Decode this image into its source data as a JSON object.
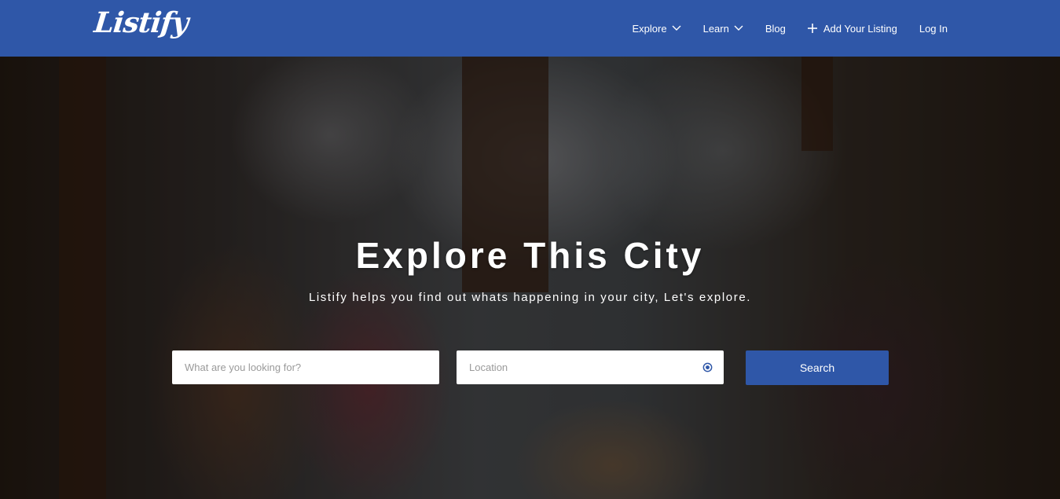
{
  "header": {
    "logo": "Listify",
    "nav": [
      {
        "label": "Explore",
        "has_dropdown": true
      },
      {
        "label": "Learn",
        "has_dropdown": true
      },
      {
        "label": "Blog",
        "has_dropdown": false
      },
      {
        "label": "Add Your Listing",
        "icon": "plus-icon"
      },
      {
        "label": "Log In",
        "has_dropdown": false
      }
    ]
  },
  "hero": {
    "title": "Explore This City",
    "subtitle": "Listify helps you find out whats happening in your city, Let's explore.",
    "search": {
      "keyword_placeholder": "What are you looking for?",
      "location_placeholder": "Location",
      "location_icon": "locate-icon",
      "button_label": "Search"
    }
  },
  "colors": {
    "brand": "#2f57a8",
    "text_on_brand": "#ffffff"
  }
}
